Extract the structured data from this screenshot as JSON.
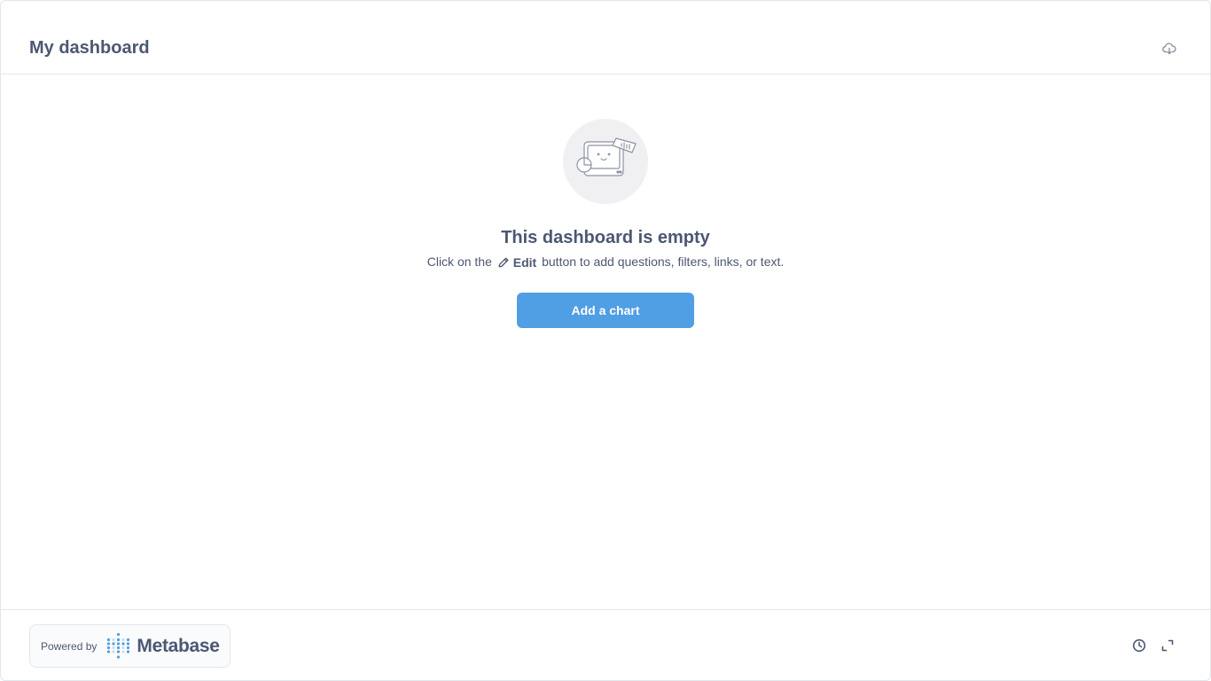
{
  "header": {
    "title": "My dashboard",
    "download_icon": "cloud-download-icon"
  },
  "empty_state": {
    "illustration": "empty-dashboard-illustration",
    "title": "This dashboard is empty",
    "desc_before": "Click on the",
    "edit_icon": "pencil-icon",
    "edit_label": "Edit",
    "desc_after": "button to add questions, filters, links, or text.",
    "add_button_label": "Add a chart"
  },
  "footer": {
    "powered_by": "Powered by",
    "brand": "Metabase",
    "history_icon": "clock-icon",
    "fullscreen_icon": "expand-icon"
  },
  "colors": {
    "brand": "#509ee3",
    "text": "#4c5773",
    "border": "#e3e7ea"
  }
}
